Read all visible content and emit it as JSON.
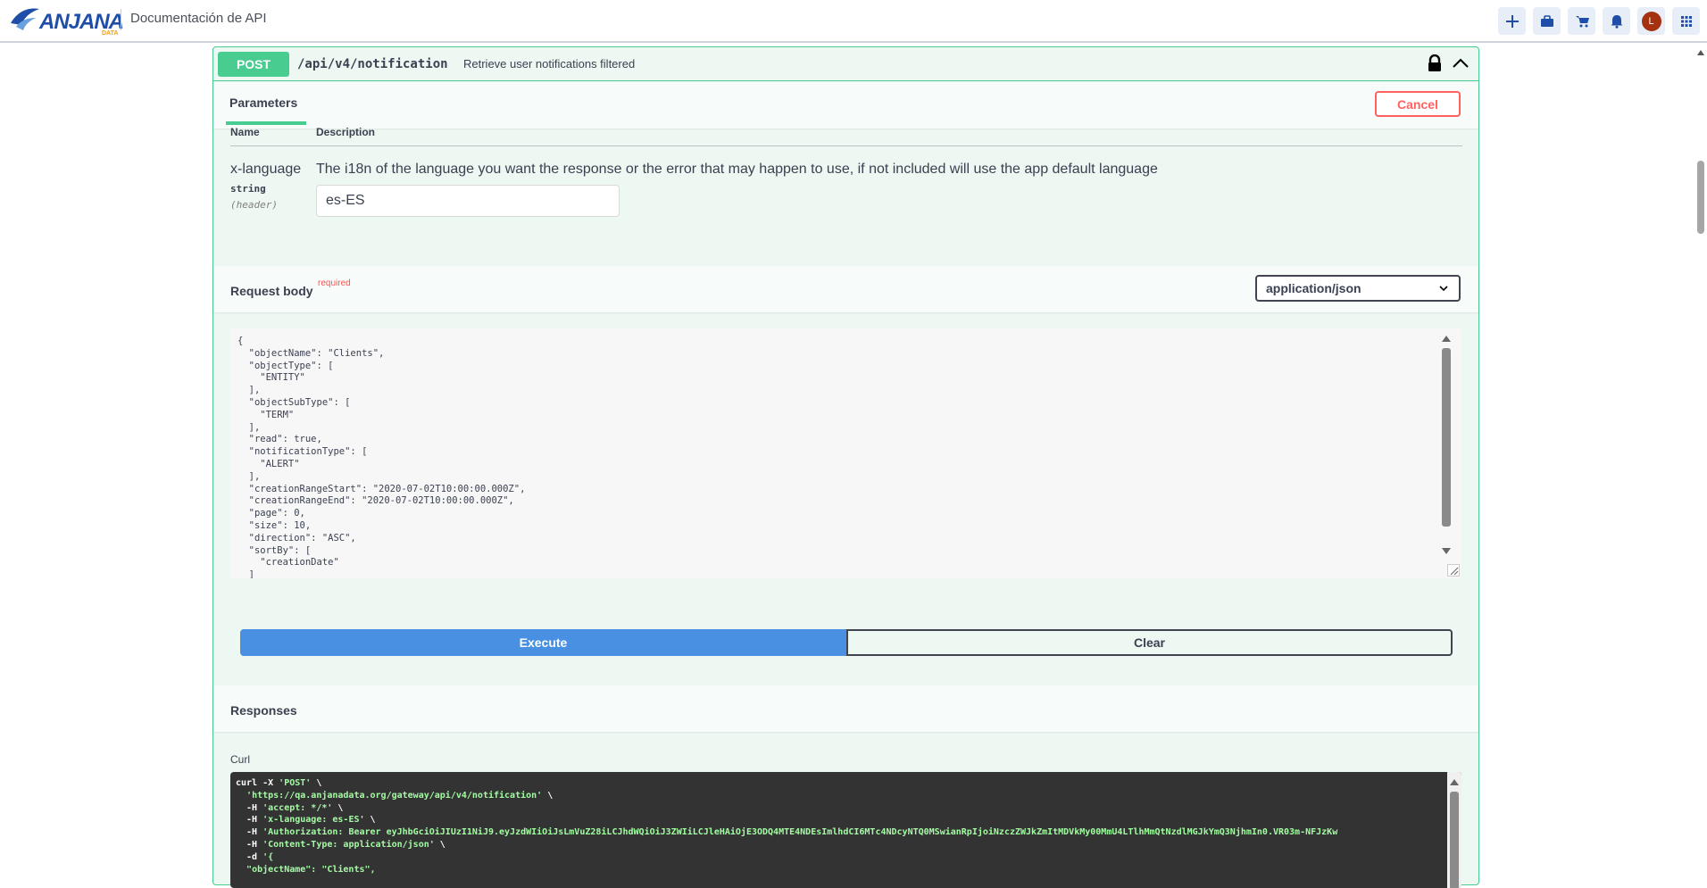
{
  "header": {
    "logo_text": "ANJANA",
    "logo_subtext": "DATA",
    "title": "Documentación de API",
    "avatar_initial": "L",
    "actions": [
      "plus-icon",
      "briefcase-icon",
      "cart-icon",
      "bell-icon",
      "avatar",
      "grid-icon"
    ]
  },
  "operation": {
    "method": "POST",
    "path": "/api/v4/notification",
    "summary": "Retrieve user notifications filtered"
  },
  "parameters": {
    "tab_label": "Parameters",
    "cancel_label": "Cancel",
    "col_name": "Name",
    "col_description": "Description",
    "items": [
      {
        "name": "x-language",
        "type": "string",
        "in": "(header)",
        "description": "The i18n of the language you want the response or the error that may happen to use, if not included will use the app default language",
        "value": "es-ES"
      }
    ]
  },
  "request_body": {
    "title": "Request body",
    "required_label": "required",
    "content_type": "application/json",
    "body": "{\n  \"objectName\": \"Clients\",\n  \"objectType\": [\n    \"ENTITY\"\n  ],\n  \"objectSubType\": [\n    \"TERM\"\n  ],\n  \"read\": true,\n  \"notificationType\": [\n    \"ALERT\"\n  ],\n  \"creationRangeStart\": \"2020-07-02T10:00:00.000Z\",\n  \"creationRangeEnd\": \"2020-07-02T10:00:00.000Z\",\n  \"page\": 0,\n  \"size\": 10,\n  \"direction\": \"ASC\",\n  \"sortBy\": [\n    \"creationDate\"\n  ]"
  },
  "actions": {
    "execute_label": "Execute",
    "clear_label": "Clear"
  },
  "responses": {
    "title": "Responses",
    "curl_label": "Curl",
    "curl_lines": [
      {
        "cmd": "curl -X ",
        "str": "'POST'",
        "tail": " \\"
      },
      {
        "cmd": "  ",
        "str": "'https://qa.anjanadata.org/gateway/api/v4/notification'",
        "tail": " \\"
      },
      {
        "cmd": "  -H ",
        "str": "'accept: */*'",
        "tail": " \\"
      },
      {
        "cmd": "  -H ",
        "str": "'x-language: es-ES'",
        "tail": " \\"
      },
      {
        "cmd": "  -H ",
        "str": "'Authorization: Bearer eyJhbGciOiJIUzI1NiJ9.eyJzdWIiOiJsLmVuZ28iLCJhdWQiOiJ3ZWIiLCJleHAiOjE3ODQ4MTE4NDEsImlhdCI6MTc4NDcyNTQ0MSwianRpIjoiNzczZWJkZmItMDVkMy00MmU4LTlhMmQtNzdlMGJkYmQ3NjhmIn0.VR03m-NFJzKw",
        "tail": ""
      },
      {
        "cmd": "  -H ",
        "str": "'Content-Type: application/json'",
        "tail": " \\"
      },
      {
        "cmd": "  -d ",
        "str": "'{",
        "tail": ""
      },
      {
        "cmd": "  ",
        "str": "\"objectName\": \"Clients\",",
        "tail": ""
      }
    ]
  },
  "colors": {
    "post_green": "#49cc90",
    "execute_blue": "#4990e2",
    "cancel_red": "#ff6060",
    "brand_blue": "#1f4ea8"
  }
}
